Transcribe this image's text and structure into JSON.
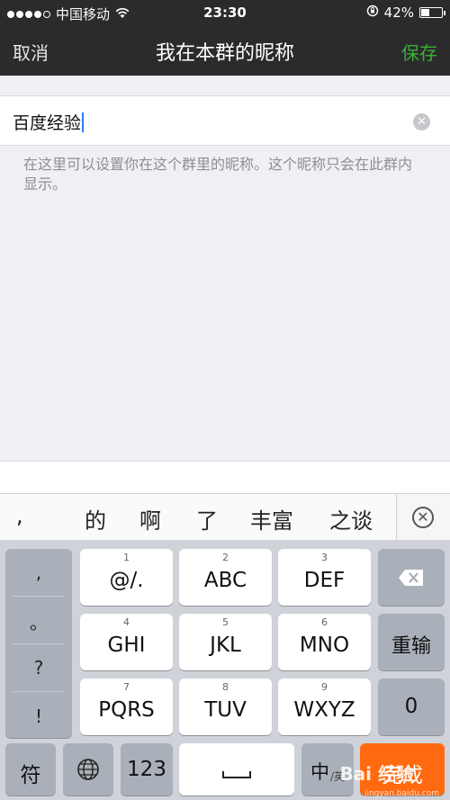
{
  "status_bar": {
    "carrier": "中国移动",
    "time": "23:30",
    "battery_percent": "42%",
    "battery_level": 0.42
  },
  "nav": {
    "cancel": "取消",
    "title": "我在本群的昵称",
    "save": "保存"
  },
  "input": {
    "value": "百度经验",
    "clear_icon": "clear-circle-icon"
  },
  "hint": "在这里可以设置你在这个群里的昵称。这个昵称只会在此群内显示。",
  "candidates": [
    ",",
    "的",
    "啊",
    "了",
    "丰富",
    "之谈"
  ],
  "keyboard": {
    "punct": [
      ",",
      "。",
      "?",
      "!"
    ],
    "keys": [
      {
        "num": "1",
        "label": "@/."
      },
      {
        "num": "2",
        "label": "ABC"
      },
      {
        "num": "3",
        "label": "DEF"
      },
      {
        "num": "4",
        "label": "GHI"
      },
      {
        "num": "5",
        "label": "JKL"
      },
      {
        "num": "6",
        "label": "MNO"
      },
      {
        "num": "7",
        "label": "PQRS"
      },
      {
        "num": "8",
        "label": "TUV"
      },
      {
        "num": "9",
        "label": "WXYZ"
      }
    ],
    "retype": "重输",
    "zero": "0",
    "symbols": "符",
    "numbers": "123",
    "lang_main": "中",
    "lang_sub": "/英",
    "space": "␣",
    "done": "完成"
  },
  "watermark": {
    "text": "Bai 经验",
    "sub": "jingyan.baidu.com"
  },
  "colors": {
    "nav_bg": "#2b2b2d",
    "save_green": "#3cb034",
    "done_orange": "#ff6a10",
    "cursor_blue": "#2f7bf5"
  }
}
